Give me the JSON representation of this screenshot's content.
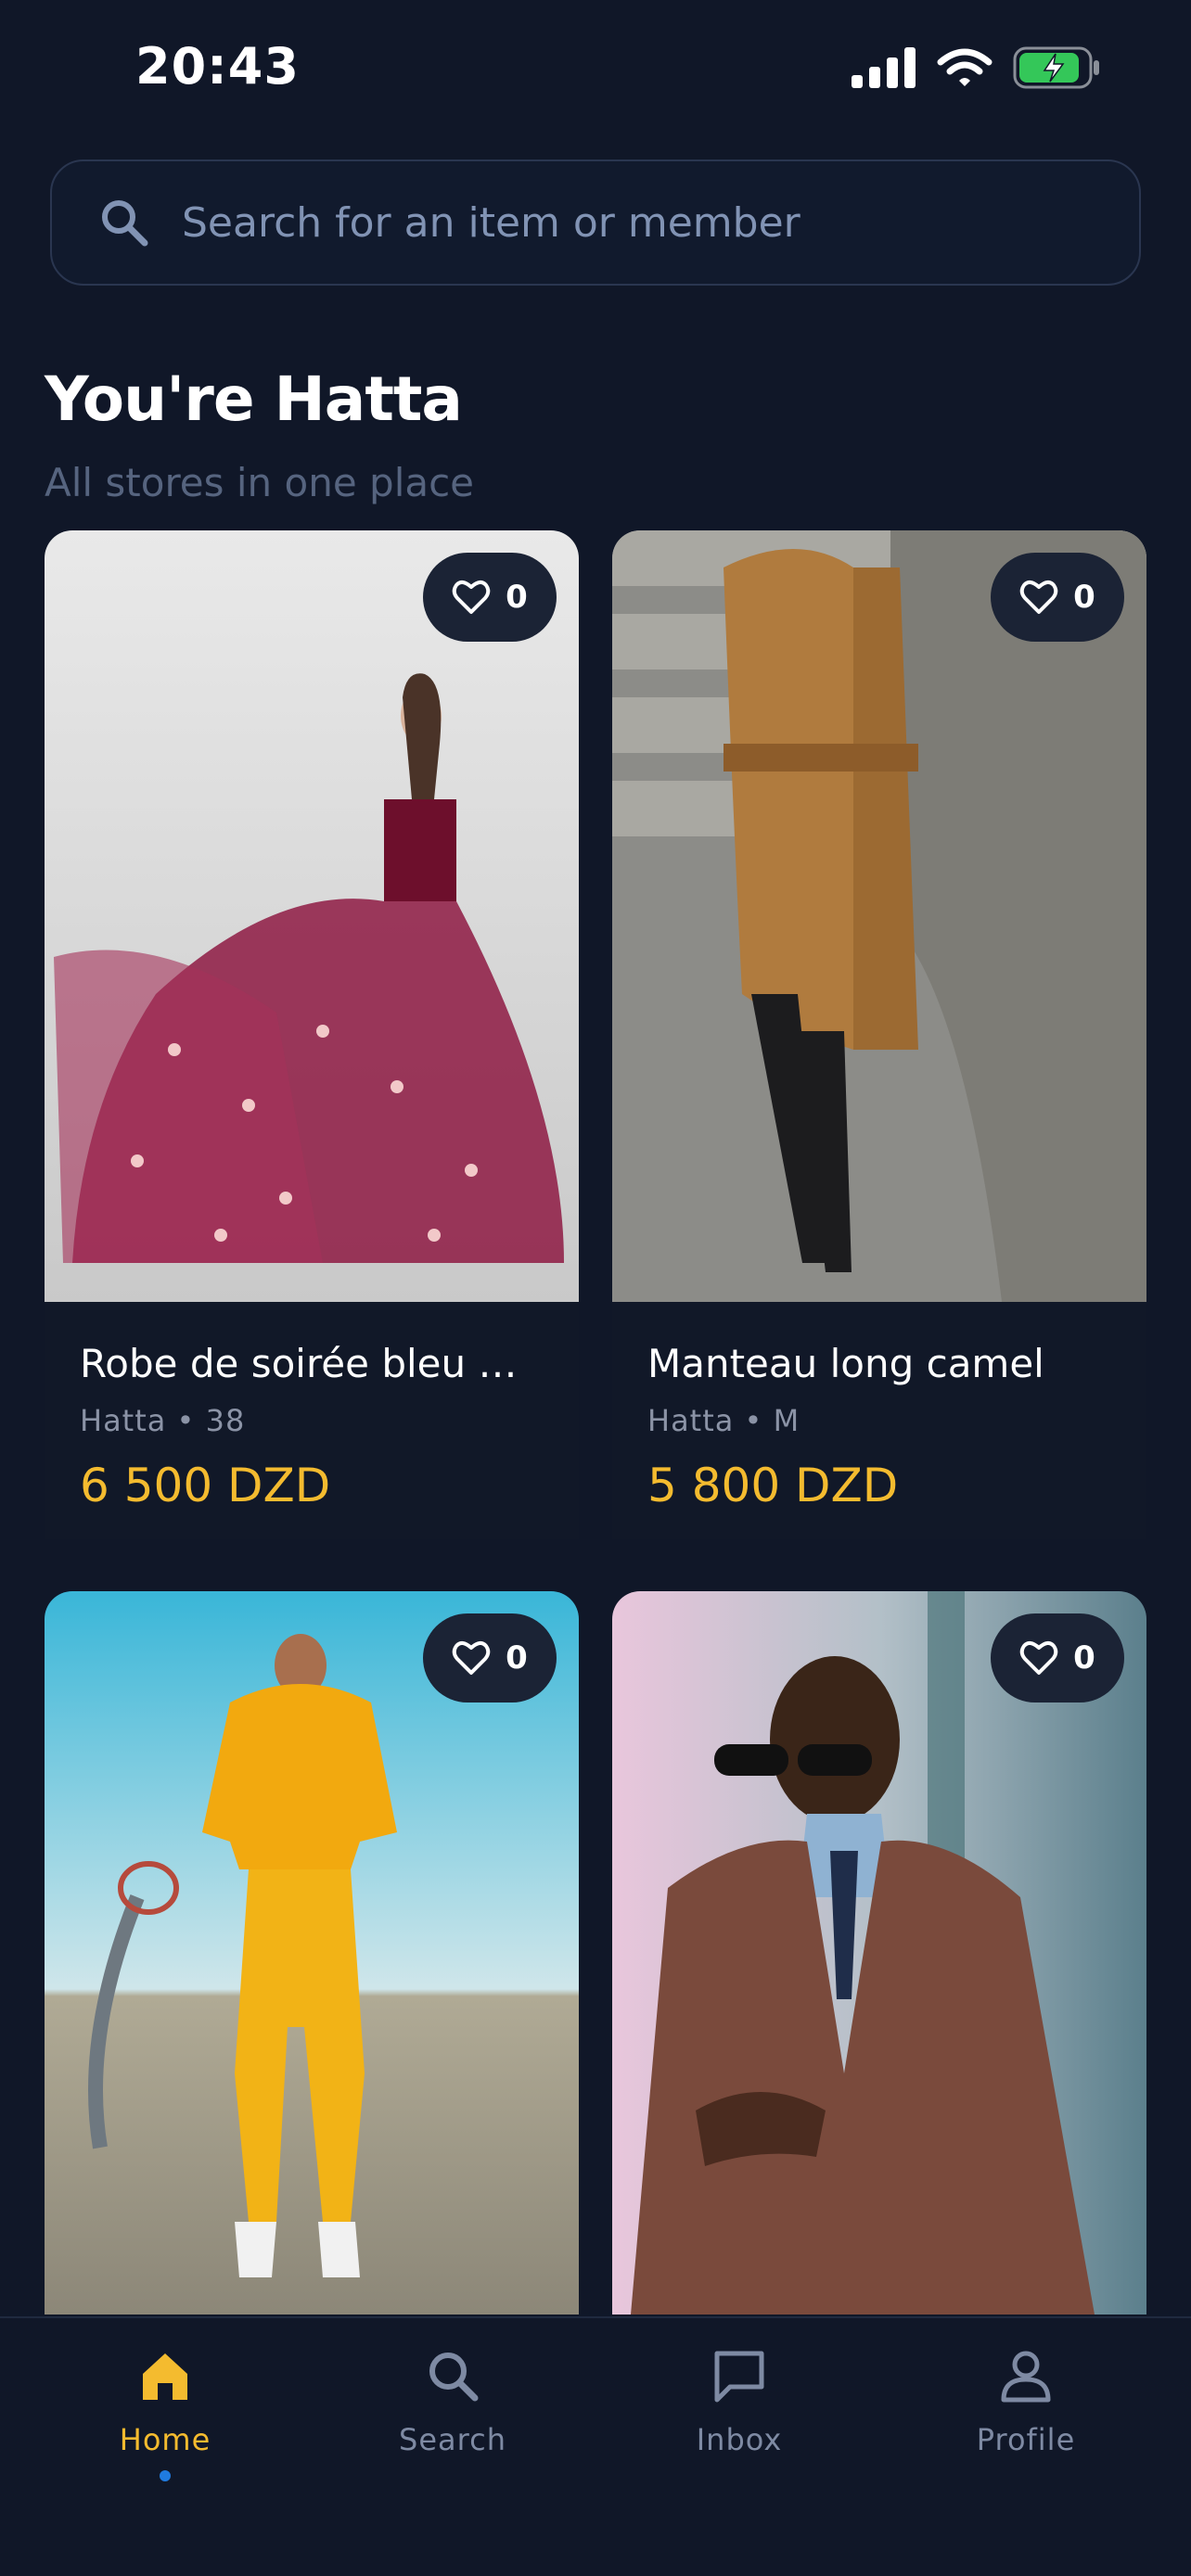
{
  "status_bar": {
    "time": "20:43"
  },
  "search": {
    "placeholder": "Search for an item or member"
  },
  "header": {
    "title": "You're Hatta",
    "subtitle": "All stores in one place"
  },
  "products": [
    {
      "title": "Robe de soirée bleu m...",
      "meta": "Hatta • 38",
      "price": "6 500 DZD",
      "likes": "0"
    },
    {
      "title": "Manteau long camel",
      "meta": "Hatta • M",
      "price": "5 800 DZD",
      "likes": "0"
    },
    {
      "title": "",
      "meta": "",
      "price": "",
      "likes": "0"
    },
    {
      "title": "",
      "meta": "",
      "price": "",
      "likes": "0"
    }
  ],
  "nav": {
    "items": [
      {
        "label": "Home",
        "icon": "home-icon",
        "active": true
      },
      {
        "label": "Search",
        "icon": "search-icon",
        "active": false
      },
      {
        "label": "Inbox",
        "icon": "chat-icon",
        "active": false
      },
      {
        "label": "Profile",
        "icon": "profile-icon",
        "active": false
      }
    ]
  },
  "colors": {
    "background": "#101728",
    "accent": "#f4bb2f",
    "active_dot": "#1f7be0",
    "muted_text": "#8b93a6"
  }
}
